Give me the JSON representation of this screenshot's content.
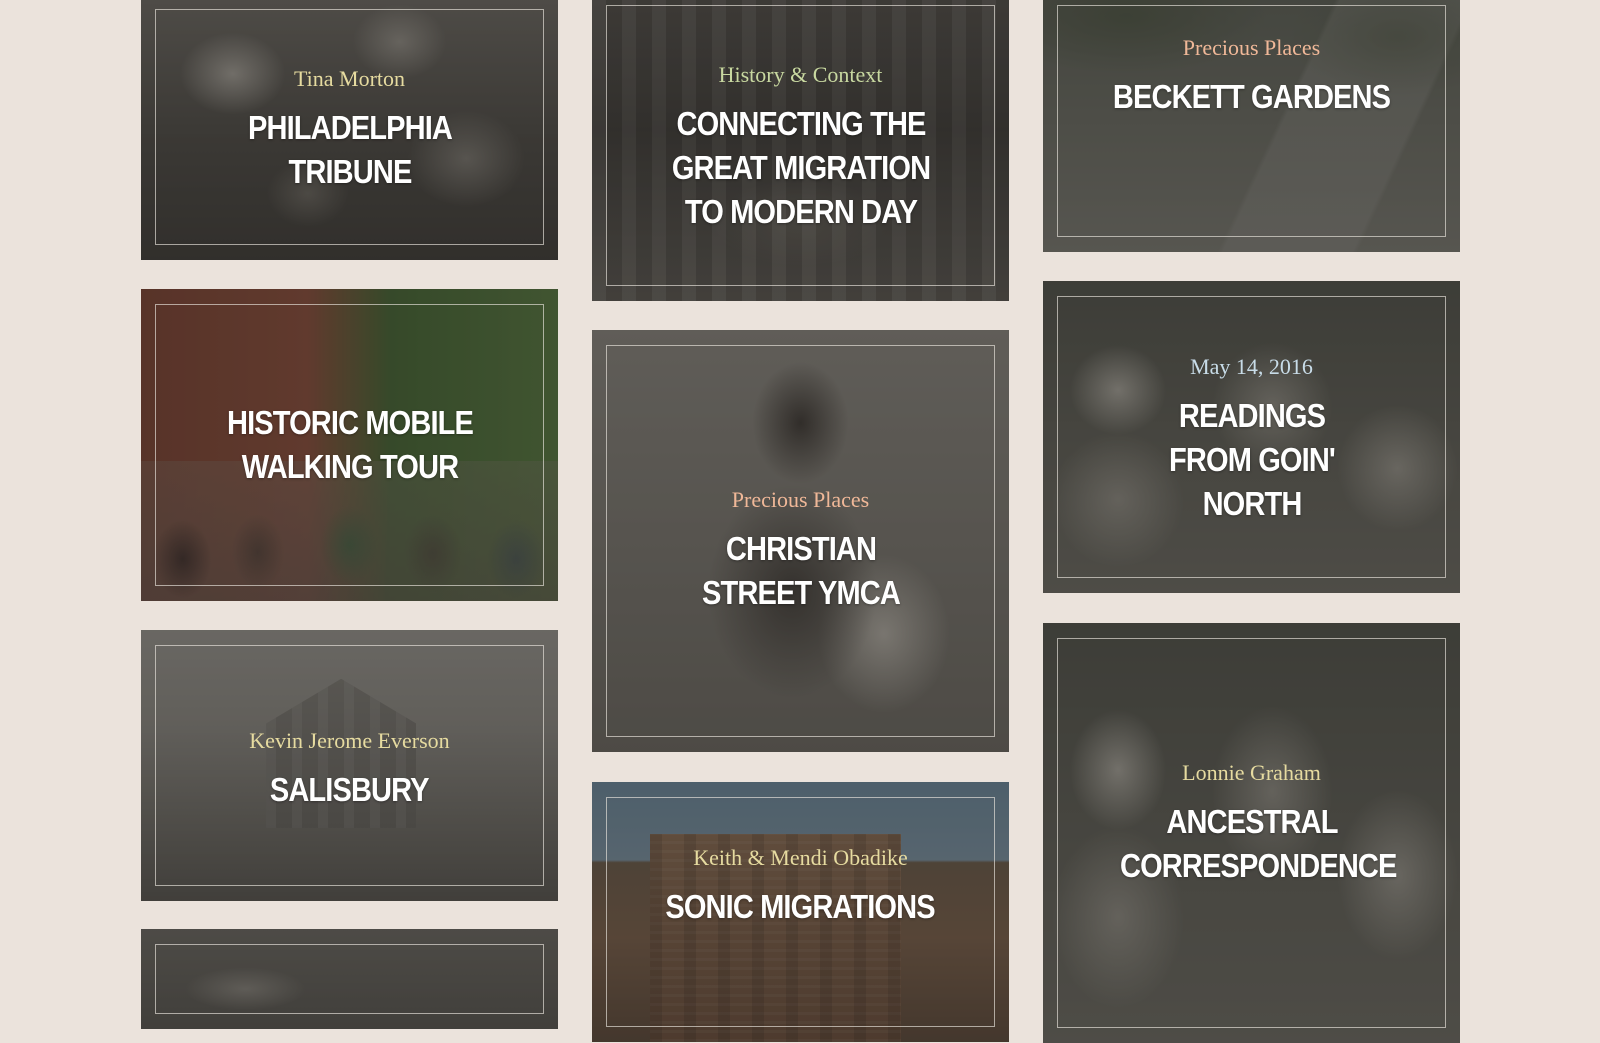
{
  "cards": [
    {
      "label": "Tina Morton",
      "title": "Philadelphia Tribune",
      "label_color": "#e6dba0"
    },
    {
      "label": "",
      "title": "Historic Mobile Walking Tour",
      "label_color": "#e6dba0"
    },
    {
      "label": "Kevin Jerome Everson",
      "title": "Salisbury",
      "label_color": "#e6dba0"
    },
    {
      "label": "",
      "title": "",
      "label_color": "#e6dba0"
    },
    {
      "label": "History & Context",
      "title": "Connecting the Great Migration to Modern Day",
      "label_color": "#c8d8a0"
    },
    {
      "label": "Precious Places",
      "title": "Christian Street YMCA",
      "label_color": "#f0b898"
    },
    {
      "label": "Keith & Mendi Obadike",
      "title": "Sonic Migrations",
      "label_color": "#e6dba0"
    },
    {
      "label": "Precious Places",
      "title": "Beckett Gardens",
      "label_color": "#f0b898"
    },
    {
      "label": "May 14, 2016",
      "title": "Readings from Goin' North",
      "label_color": "#c8dce8"
    },
    {
      "label": "Lonnie Graham",
      "title": "Ancestral Correspondence",
      "label_color": "#e6dba0"
    }
  ]
}
